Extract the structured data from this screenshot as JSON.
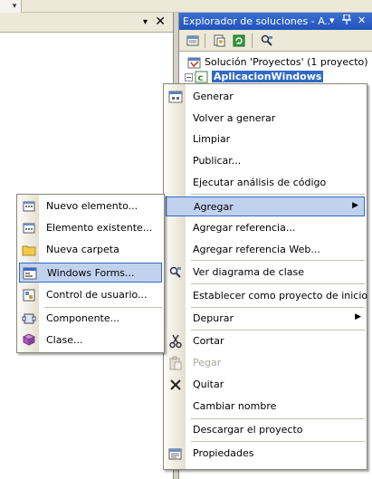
{
  "left_panel": {
    "dropdown_glyph": "▾",
    "close_glyph": "✕"
  },
  "solution_explorer": {
    "title": "Explorador de soluciones - A...",
    "title_pin": "ᵖ",
    "title_dropdown": "▾",
    "title_close": "✕",
    "solution_label": "Solución 'Proyectos' (1 proyecto)",
    "project_label": "AplicacionWindows"
  },
  "context_menu": {
    "items": [
      {
        "label": "Generar",
        "icon": "build-icon"
      },
      {
        "label": "Volver a generar"
      },
      {
        "label": "Limpiar"
      },
      {
        "label": "Publicar..."
      },
      {
        "label": "Ejecutar análisis de código"
      },
      {
        "label": "Agregar",
        "submenu": true,
        "highlighted": true
      },
      {
        "label": "Agregar referencia..."
      },
      {
        "label": "Agregar referencia Web..."
      },
      {
        "label": "Ver diagrama de clase",
        "icon": "class-diagram-icon"
      },
      {
        "label": "Establecer como proyecto de inicio"
      },
      {
        "label": "Depurar",
        "submenu": true
      },
      {
        "label": "Cortar",
        "icon": "scissors-icon"
      },
      {
        "label": "Pegar",
        "icon": "paste-icon",
        "disabled": true
      },
      {
        "label": "Quitar",
        "icon": "delete-x-icon"
      },
      {
        "label": "Cambiar nombre"
      },
      {
        "label": "Descargar el proyecto"
      },
      {
        "label": "Propiedades",
        "icon": "properties-icon"
      }
    ],
    "submenu_arrow": "▶"
  },
  "add_submenu": {
    "items": [
      {
        "label": "Nuevo elemento...",
        "icon": "new-item-icon"
      },
      {
        "label": "Elemento existente...",
        "icon": "existing-item-icon"
      },
      {
        "label": "Nueva carpeta",
        "icon": "folder-icon"
      },
      {
        "label": "Windows Forms...",
        "icon": "windows-form-icon",
        "highlighted": true
      },
      {
        "label": "Control de usuario...",
        "icon": "user-control-icon"
      },
      {
        "label": "Componente...",
        "icon": "component-icon"
      },
      {
        "label": "Clase...",
        "icon": "class-icon"
      }
    ]
  },
  "colors": {
    "title_blue": "#2153b8",
    "highlight_fill": "#c1d2ee",
    "highlight_border": "#316ac5",
    "selection_blue": "#316ac5"
  }
}
